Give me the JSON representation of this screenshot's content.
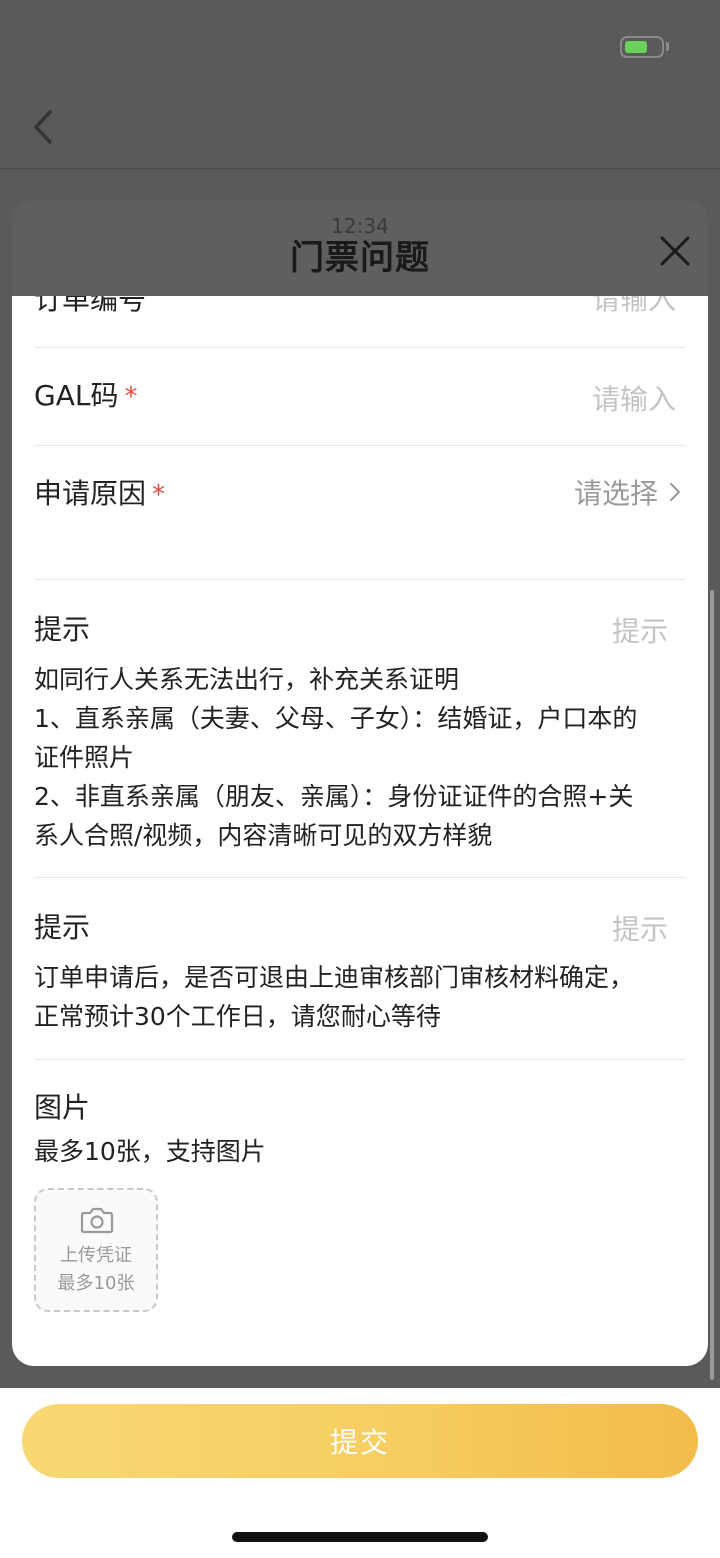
{
  "status_bar": {
    "time_ghost": "12:34",
    "battery_color": "#6ad25a"
  },
  "sheet": {
    "title": "门票问题"
  },
  "form": {
    "order_number": {
      "label": "订单编号",
      "placeholder": "请输入"
    },
    "gal_code": {
      "label": "GAL码",
      "required_mark": "*",
      "placeholder": "请输入"
    },
    "apply_reason": {
      "label": "申请原因",
      "required_mark": "*",
      "value": "请选择"
    },
    "tip1": {
      "label": "提示",
      "right": "提示",
      "lines": [
        "如同行人关系无法出行，补充关系证明",
        "1、直系亲属（夫妻、父母、子女）：结婚证，户口本的",
        "证件照片",
        "2、非直系亲属（朋友、亲属）：身份证证件的合照+关",
        "系人合照/视频，内容清晰可见的双方样貌"
      ]
    },
    "tip2": {
      "label": "提示",
      "right": "提示",
      "lines": [
        "订单申请后，是否可退由上迪审核部门审核材料确定，",
        "正常预计30个工作日，请您耐心等待"
      ]
    },
    "images": {
      "label": "图片",
      "hint": "最多10张，支持图片",
      "upload_line1": "上传凭证",
      "upload_line2": "最多10张"
    }
  },
  "submit": {
    "label": "提交",
    "gradient_start": "#f8d873",
    "gradient_end": "#f2bc49"
  },
  "colors": {
    "required": "#e0493b",
    "placeholder": "#c4c4c4",
    "overlay": "#5a5a5a"
  }
}
